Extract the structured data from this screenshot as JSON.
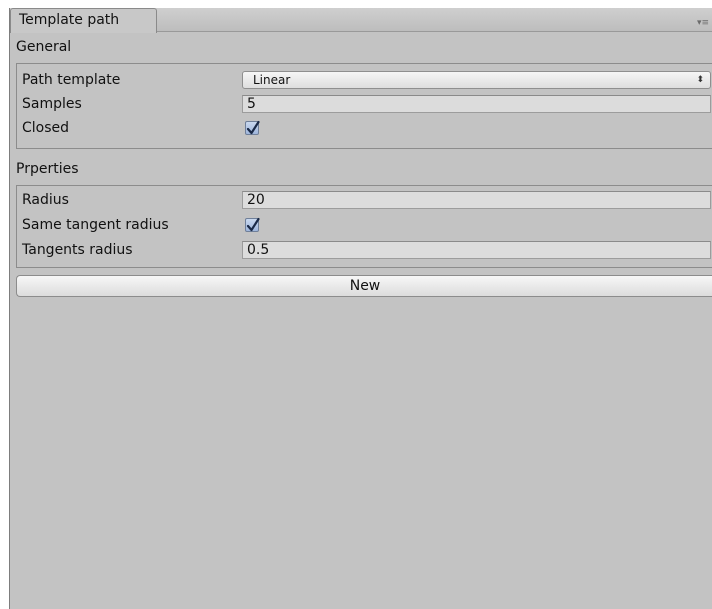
{
  "tab": {
    "title": "Template path"
  },
  "general": {
    "title": "General",
    "path_template": {
      "label": "Path template",
      "value": "Linear"
    },
    "samples": {
      "label": "Samples",
      "value": "5"
    },
    "closed": {
      "label": "Closed",
      "checked": true
    }
  },
  "properties": {
    "title": "Prperties",
    "radius": {
      "label": "Radius",
      "value": "20"
    },
    "same_tangent_radius": {
      "label": "Same tangent radius",
      "checked": true
    },
    "tangents_radius": {
      "label": "Tangents radius",
      "value": "0.5"
    }
  },
  "new_button": {
    "label": "New"
  },
  "icons": {
    "menu": "menu-icon",
    "checkmark": "checkmark-icon",
    "dropdown": "up-down-arrows-icon"
  }
}
